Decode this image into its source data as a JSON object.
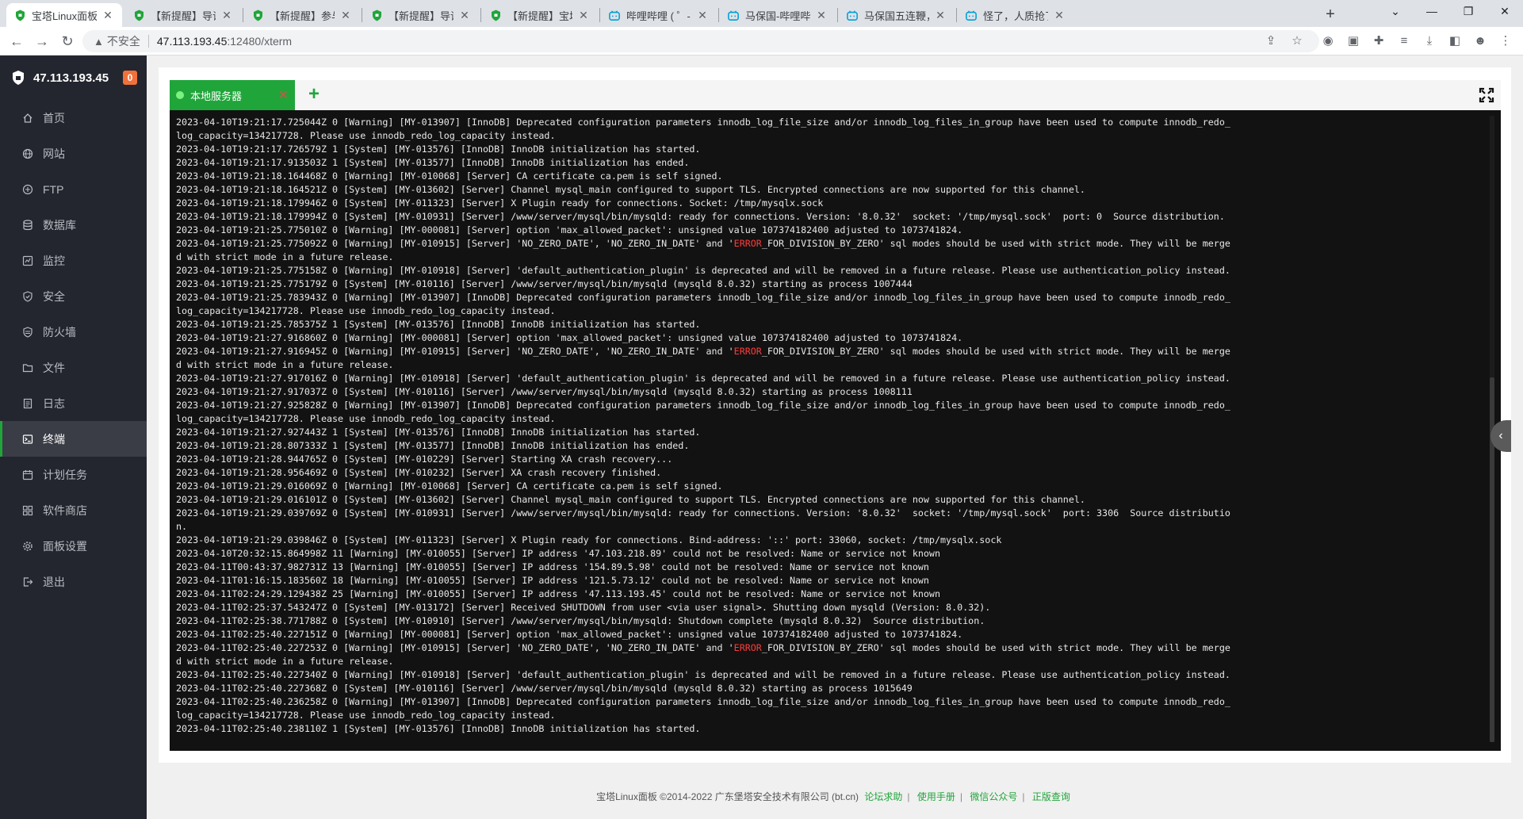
{
  "browser": {
    "tabs": [
      {
        "title": "宝塔Linux面板",
        "icon": "bt-shield-icon",
        "active": true
      },
      {
        "title": "【新提醒】导读-我的笔",
        "icon": "bt-shield-icon"
      },
      {
        "title": "【新提醒】参与/回复主",
        "icon": "bt-shield-icon"
      },
      {
        "title": "【新提醒】导读-我的笔",
        "icon": "bt-shield-icon"
      },
      {
        "title": "【新提醒】宝塔面板-",
        "icon": "bt-shield-icon"
      },
      {
        "title": "哔哩哔哩 ( ゜- ゜)つロ",
        "icon": "bilibili-icon"
      },
      {
        "title": "马保国-哔哩哔哩_Bilib",
        "icon": "bilibili-icon"
      },
      {
        "title": "马保国五连鞭，但是",
        "icon": "bilibili-icon"
      },
      {
        "title": "怪了，人质抢了劫匪",
        "icon": "bilibili-icon"
      }
    ],
    "new_tab": "+",
    "url_warning": "不安全",
    "url_host": "47.113.193.45",
    "url_path": ":12480/xterm"
  },
  "sidebar": {
    "server_ip": "47.113.193.45",
    "badge": "0",
    "items": [
      {
        "label": "首页",
        "icon": "home-icon"
      },
      {
        "label": "网站",
        "icon": "globe-icon"
      },
      {
        "label": "FTP",
        "icon": "ftp-icon"
      },
      {
        "label": "数据库",
        "icon": "database-icon"
      },
      {
        "label": "监控",
        "icon": "monitor-icon"
      },
      {
        "label": "安全",
        "icon": "shield-icon"
      },
      {
        "label": "防火墙",
        "icon": "firewall-icon"
      },
      {
        "label": "文件",
        "icon": "folder-icon"
      },
      {
        "label": "日志",
        "icon": "log-icon"
      },
      {
        "label": "终端",
        "icon": "terminal-icon",
        "active": true
      },
      {
        "label": "计划任务",
        "icon": "calendar-icon"
      },
      {
        "label": "软件商店",
        "icon": "store-icon"
      },
      {
        "label": "面板设置",
        "icon": "gear-icon"
      },
      {
        "label": "退出",
        "icon": "logout-icon"
      }
    ]
  },
  "terminal": {
    "tab_label": "本地服务器",
    "add_tab": "+",
    "lines": [
      "2023-04-10T19:21:17.725044Z 0 [Warning] [MY-013907] [InnoDB] Deprecated configuration parameters innodb_log_file_size and/or innodb_log_files_in_group have been used to compute innodb_redo_",
      "log_capacity=134217728. Please use innodb_redo_log_capacity instead.",
      "2023-04-10T19:21:17.726579Z 1 [System] [MY-013576] [InnoDB] InnoDB initialization has started.",
      "2023-04-10T19:21:17.913503Z 1 [System] [MY-013577] [InnoDB] InnoDB initialization has ended.",
      "2023-04-10T19:21:18.164468Z 0 [Warning] [MY-010068] [Server] CA certificate ca.pem is self signed.",
      "2023-04-10T19:21:18.164521Z 0 [System] [MY-013602] [Server] Channel mysql_main configured to support TLS. Encrypted connections are now supported for this channel.",
      "2023-04-10T19:21:18.179946Z 0 [System] [MY-011323] [Server] X Plugin ready for connections. Socket: /tmp/mysqlx.sock",
      "2023-04-10T19:21:18.179994Z 0 [System] [MY-010931] [Server] /www/server/mysql/bin/mysqld: ready for connections. Version: '8.0.32'  socket: '/tmp/mysql.sock'  port: 0  Source distribution.",
      "2023-04-10T19:21:25.775010Z 0 [Warning] [MY-000081] [Server] option 'max_allowed_packet': unsigned value 107374182400 adjusted to 1073741824.",
      "2023-04-10T19:21:25.775092Z 0 [Warning] [MY-010915] [Server] 'NO_ZERO_DATE', 'NO_ZERO_IN_DATE' and 'ERROR_FOR_DIVISION_BY_ZERO' sql modes should be used with strict mode. They will be merge",
      "d with strict mode in a future release.",
      "2023-04-10T19:21:25.775158Z 0 [Warning] [MY-010918] [Server] 'default_authentication_plugin' is deprecated and will be removed in a future release. Please use authentication_policy instead.",
      "2023-04-10T19:21:25.775179Z 0 [System] [MY-010116] [Server] /www/server/mysql/bin/mysqld (mysqld 8.0.32) starting as process 1007444",
      "2023-04-10T19:21:25.783943Z 0 [Warning] [MY-013907] [InnoDB] Deprecated configuration parameters innodb_log_file_size and/or innodb_log_files_in_group have been used to compute innodb_redo_",
      "log_capacity=134217728. Please use innodb_redo_log_capacity instead.",
      "2023-04-10T19:21:25.785375Z 1 [System] [MY-013576] [InnoDB] InnoDB initialization has started.",
      "2023-04-10T19:21:27.916860Z 0 [Warning] [MY-000081] [Server] option 'max_allowed_packet': unsigned value 107374182400 adjusted to 1073741824.",
      "2023-04-10T19:21:27.916945Z 0 [Warning] [MY-010915] [Server] 'NO_ZERO_DATE', 'NO_ZERO_IN_DATE' and 'ERROR_FOR_DIVISION_BY_ZERO' sql modes should be used with strict mode. They will be merge",
      "d with strict mode in a future release.",
      "2023-04-10T19:21:27.917016Z 0 [Warning] [MY-010918] [Server] 'default_authentication_plugin' is deprecated and will be removed in a future release. Please use authentication_policy instead.",
      "2023-04-10T19:21:27.917037Z 0 [System] [MY-010116] [Server] /www/server/mysql/bin/mysqld (mysqld 8.0.32) starting as process 1008111",
      "2023-04-10T19:21:27.925828Z 0 [Warning] [MY-013907] [InnoDB] Deprecated configuration parameters innodb_log_file_size and/or innodb_log_files_in_group have been used to compute innodb_redo_",
      "log_capacity=134217728. Please use innodb_redo_log_capacity instead.",
      "2023-04-10T19:21:27.927443Z 1 [System] [MY-013576] [InnoDB] InnoDB initialization has started.",
      "2023-04-10T19:21:28.807333Z 1 [System] [MY-013577] [InnoDB] InnoDB initialization has ended.",
      "2023-04-10T19:21:28.944765Z 0 [System] [MY-010229] [Server] Starting XA crash recovery...",
      "2023-04-10T19:21:28.956469Z 0 [System] [MY-010232] [Server] XA crash recovery finished.",
      "2023-04-10T19:21:29.016069Z 0 [Warning] [MY-010068] [Server] CA certificate ca.pem is self signed.",
      "2023-04-10T19:21:29.016101Z 0 [System] [MY-013602] [Server] Channel mysql_main configured to support TLS. Encrypted connections are now supported for this channel.",
      "2023-04-10T19:21:29.039769Z 0 [System] [MY-010931] [Server] /www/server/mysql/bin/mysqld: ready for connections. Version: '8.0.32'  socket: '/tmp/mysql.sock'  port: 3306  Source distributio",
      "n.",
      "2023-04-10T19:21:29.039846Z 0 [System] [MY-011323] [Server] X Plugin ready for connections. Bind-address: '::' port: 33060, socket: /tmp/mysqlx.sock",
      "2023-04-10T20:32:15.864998Z 11 [Warning] [MY-010055] [Server] IP address '47.103.218.89' could not be resolved: Name or service not known",
      "2023-04-11T00:43:37.982731Z 13 [Warning] [MY-010055] [Server] IP address '154.89.5.98' could not be resolved: Name or service not known",
      "2023-04-11T01:16:15.183560Z 18 [Warning] [MY-010055] [Server] IP address '121.5.73.12' could not be resolved: Name or service not known",
      "2023-04-11T02:24:29.129438Z 25 [Warning] [MY-010055] [Server] IP address '47.113.193.45' could not be resolved: Name or service not known",
      "2023-04-11T02:25:37.543247Z 0 [System] [MY-013172] [Server] Received SHUTDOWN from user <via user signal>. Shutting down mysqld (Version: 8.0.32).",
      "2023-04-11T02:25:38.771788Z 0 [System] [MY-010910] [Server] /www/server/mysql/bin/mysqld: Shutdown complete (mysqld 8.0.32)  Source distribution.",
      "2023-04-11T02:25:40.227151Z 0 [Warning] [MY-000081] [Server] option 'max_allowed_packet': unsigned value 107374182400 adjusted to 1073741824.",
      "2023-04-11T02:25:40.227253Z 0 [Warning] [MY-010915] [Server] 'NO_ZERO_DATE', 'NO_ZERO_IN_DATE' and 'ERROR_FOR_DIVISION_BY_ZERO' sql modes should be used with strict mode. They will be merge",
      "d with strict mode in a future release.",
      "2023-04-11T02:25:40.227340Z 0 [Warning] [MY-010918] [Server] 'default_authentication_plugin' is deprecated and will be removed in a future release. Please use authentication_policy instead.",
      "2023-04-11T02:25:40.227368Z 0 [System] [MY-010116] [Server] /www/server/mysql/bin/mysqld (mysqld 8.0.32) starting as process 1015649",
      "2023-04-11T02:25:40.236258Z 0 [Warning] [MY-013907] [InnoDB] Deprecated configuration parameters innodb_log_file_size and/or innodb_log_files_in_group have been used to compute innodb_redo_",
      "log_capacity=134217728. Please use innodb_redo_log_capacity instead.",
      "2023-04-11T02:25:40.238110Z 1 [System] [MY-013576] [InnoDB] InnoDB initialization has started."
    ],
    "highlight_word": "ERROR",
    "highlight_color": "#ff3b3b"
  },
  "footer": {
    "copyright": "宝塔Linux面板 ©2014-2022 广东堡塔安全技术有限公司 (bt.cn)",
    "links": [
      "论坛求助",
      "使用手册",
      "微信公众号",
      "正版查询"
    ]
  },
  "colors": {
    "accent": "#20a53a",
    "sidebar_bg": "#23262e",
    "terminal_bg": "#121212",
    "badge": "#f0713a"
  }
}
